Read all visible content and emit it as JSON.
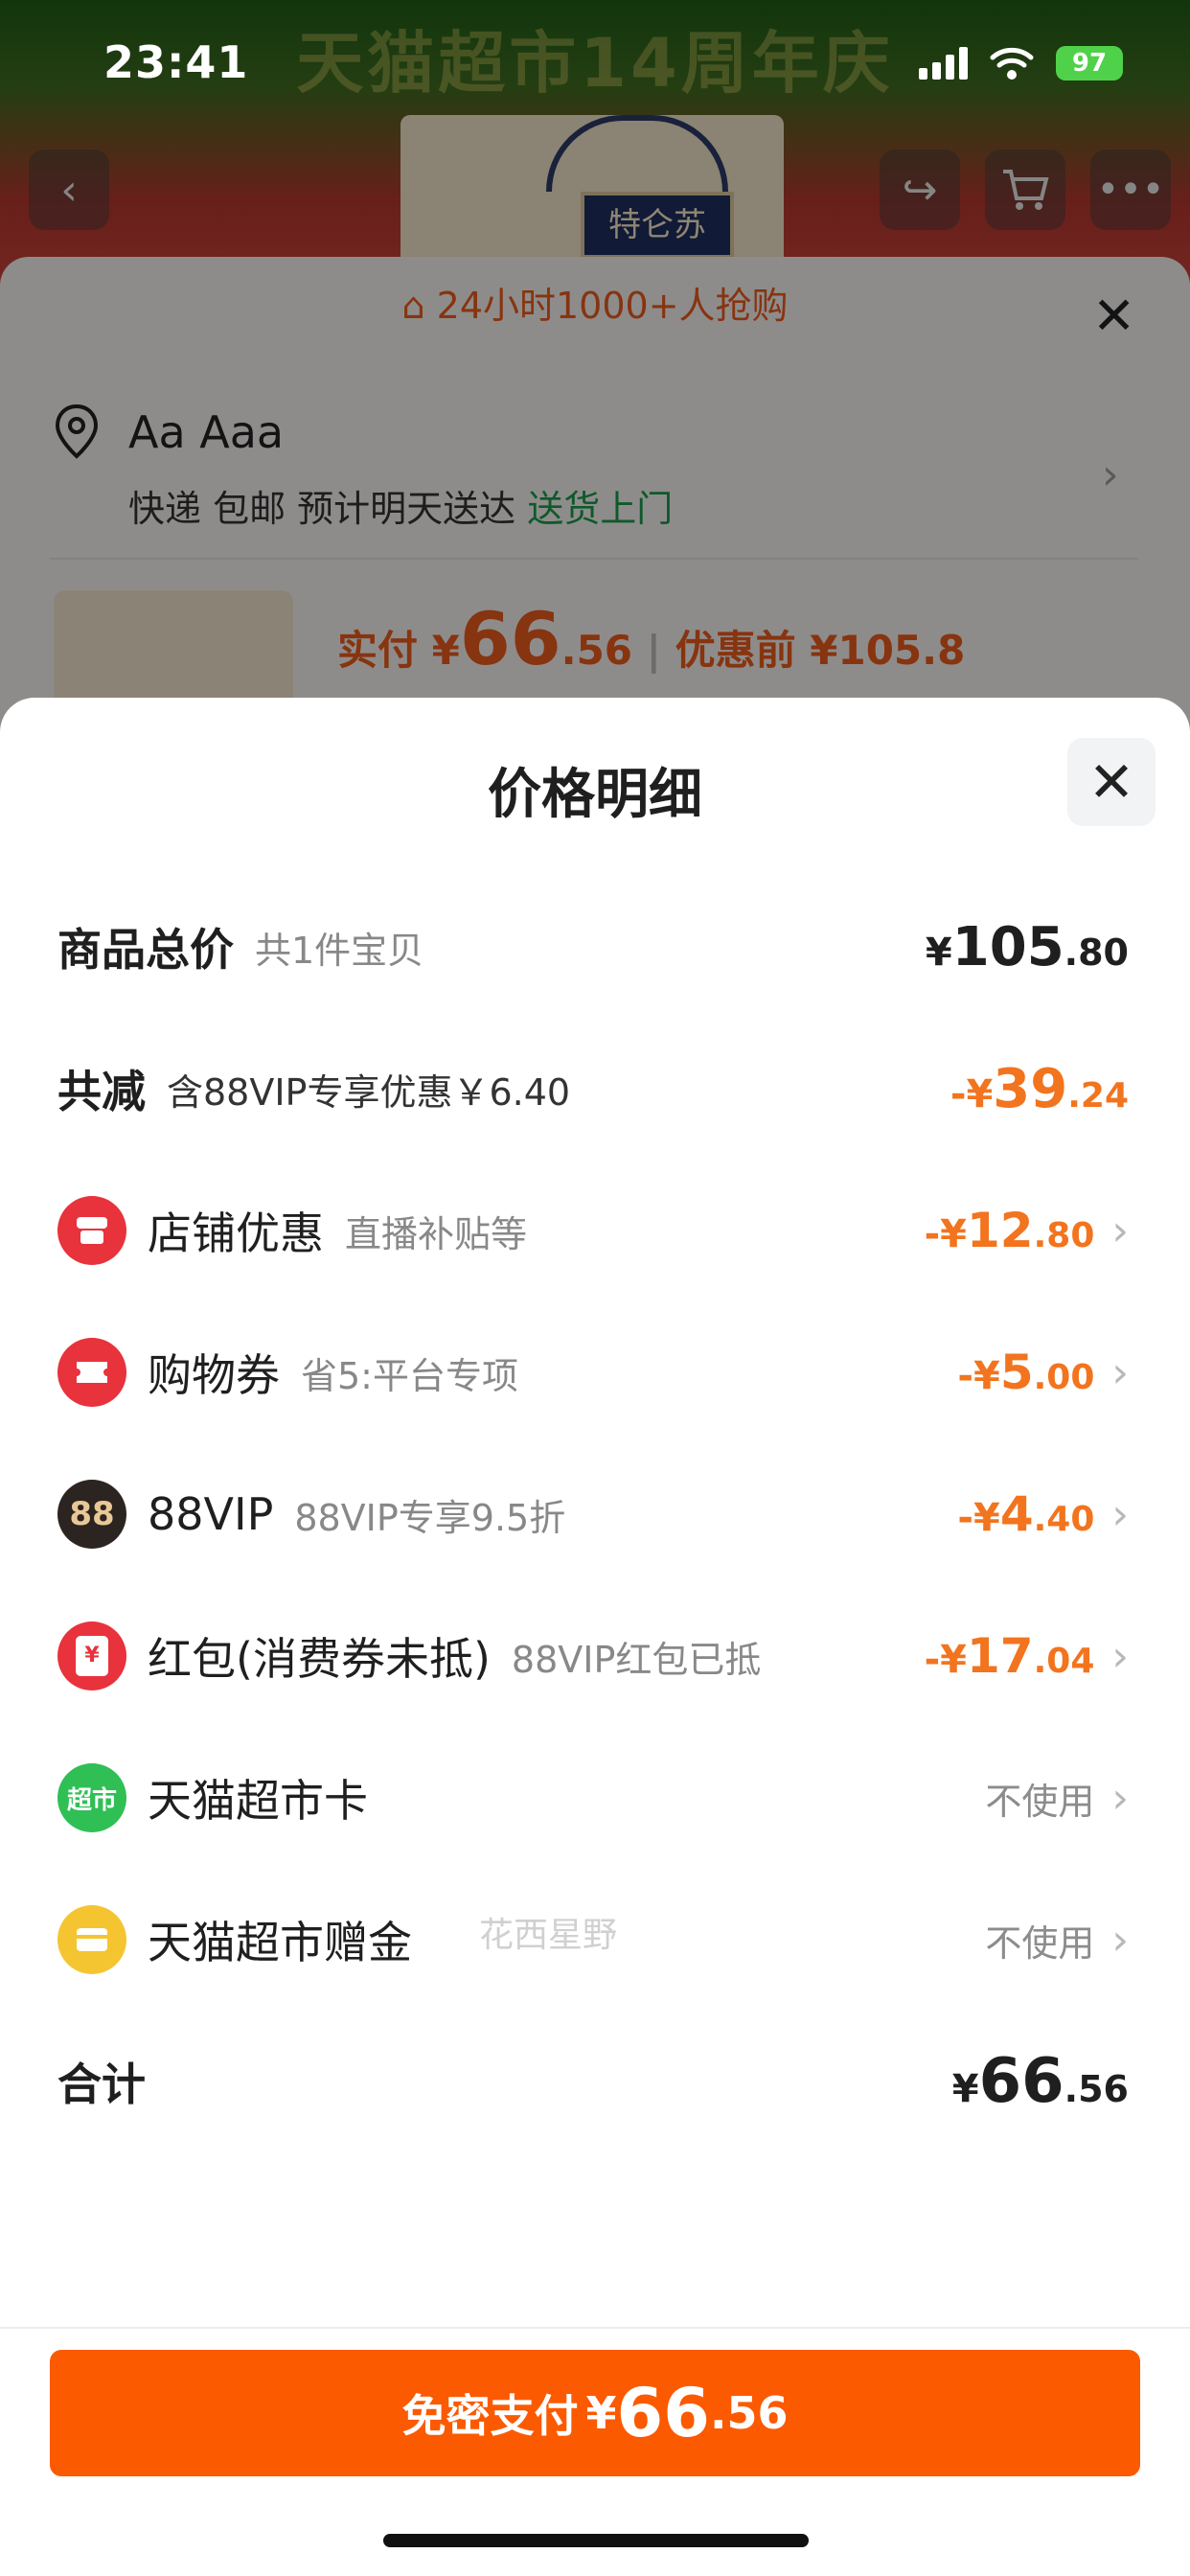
{
  "status_bar": {
    "time": "23:41",
    "battery": "97"
  },
  "background": {
    "banner_title": "天猫超市14周年庆",
    "product_label": "特仑苏",
    "hot_text": "24小时1000+人抢购",
    "address_name": "Aa Aaa",
    "shipping_text": "快递 包邮 预计明天送达",
    "shipping_highlight": "送货上门",
    "price_prefix": "实付 ¥",
    "price_int": "66",
    "price_dec": ".56",
    "price_before": "优惠前 ¥105.8"
  },
  "sheet": {
    "title": "价格明细",
    "watermark": "花西星野",
    "rows": {
      "total_goods": {
        "label": "商品总价",
        "sub": "共1件宝贝",
        "cur": "¥",
        "int": "105",
        "dec": ".80"
      },
      "total_discount": {
        "label": "共减",
        "sub": "含88VIP专享优惠￥6.40",
        "cur": "-¥",
        "int": "39",
        "dec": ".24"
      },
      "store": {
        "label": "店铺优惠",
        "sub": "直播补贴等",
        "cur": "-¥",
        "int": "12",
        "dec": ".80"
      },
      "coupon": {
        "label": "购物券",
        "sub": "省5:平台专项",
        "cur": "-¥",
        "int": "5",
        "dec": ".00"
      },
      "vip": {
        "label": "88VIP",
        "sub": "88VIP专享9.5折",
        "cur": "-¥",
        "int": "4",
        "dec": ".40",
        "icon_text": "88"
      },
      "redpacket": {
        "label": "红包(消费券未抵)",
        "sub": "88VIP红包已抵",
        "cur": "-¥",
        "int": "17",
        "dec": ".04",
        "icon_text": "¥"
      },
      "market_card": {
        "label": "天猫超市卡",
        "value": "不使用",
        "icon_text": "超市"
      },
      "market_gift": {
        "label": "天猫超市赠金",
        "value": "不使用"
      },
      "sum": {
        "label": "合计",
        "cur": "¥",
        "int": "66",
        "dec": ".56"
      }
    }
  },
  "pay_button": {
    "label": "免密支付",
    "cur": "¥",
    "int": "66",
    "dec": ".56"
  },
  "colors": {
    "accent": "#fb5a00",
    "discount": "#f2741e",
    "store_icon": "#e8323c",
    "card_icon": "#2fbf55",
    "gift_icon": "#f5c531"
  }
}
